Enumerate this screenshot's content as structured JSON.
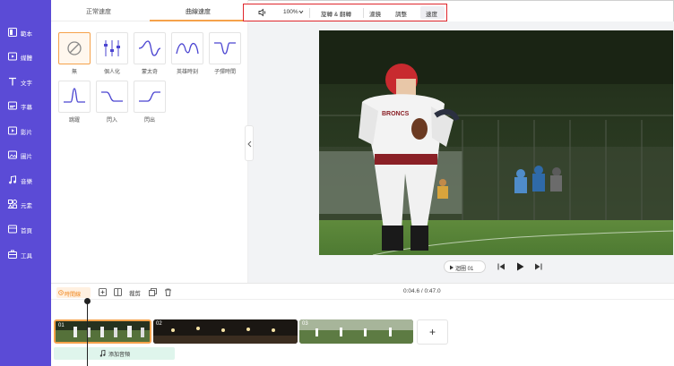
{
  "sidebar": {
    "items": [
      {
        "label": "範本",
        "icon": "template-icon"
      },
      {
        "label": "媒體",
        "icon": "media-icon"
      },
      {
        "label": "文字",
        "icon": "text-icon"
      },
      {
        "label": "字幕",
        "icon": "subtitle-icon"
      },
      {
        "label": "影片",
        "icon": "video-icon"
      },
      {
        "label": "圖片",
        "icon": "image-icon"
      },
      {
        "label": "音樂",
        "icon": "music-icon"
      },
      {
        "label": "元素",
        "icon": "elements-icon"
      },
      {
        "label": "首頁",
        "icon": "home-icon"
      },
      {
        "label": "工具",
        "icon": "tools-icon"
      }
    ]
  },
  "panel": {
    "tabs": [
      {
        "label": "正常速度",
        "active": false
      },
      {
        "label": "曲線速度",
        "active": true
      }
    ],
    "curves": [
      {
        "label": "無",
        "selected": true
      },
      {
        "label": "個人化",
        "selected": false
      },
      {
        "label": "蒙太奇",
        "selected": false
      },
      {
        "label": "英雄時刻",
        "selected": false
      },
      {
        "label": "子彈時間",
        "selected": false
      },
      {
        "label": "跳躍",
        "selected": false
      },
      {
        "label": "閃入",
        "selected": false
      },
      {
        "label": "閃出",
        "selected": false
      }
    ]
  },
  "toolbar": {
    "volume_icon": "volume-icon",
    "volume_value": "100%",
    "rotate_flip": "旋轉 & 翻轉",
    "filter": "濾鏡",
    "adjust": "調整",
    "speed": "速度"
  },
  "player": {
    "loop_label": "迴圈 01"
  },
  "timeline": {
    "history_label": "時間線",
    "split_label": "裁剪",
    "time_display": "0:04.6 / 0:47.0",
    "clips": [
      {
        "number": "01"
      },
      {
        "number": "02"
      },
      {
        "number": "03"
      }
    ],
    "add_clip": "+",
    "audio_label": "添加音頻"
  },
  "colors": {
    "sidebar": "#5b4bd6",
    "accent": "#f5a24b",
    "highlight_border": "#e0262c",
    "curve_stroke": "#4b45d1"
  }
}
